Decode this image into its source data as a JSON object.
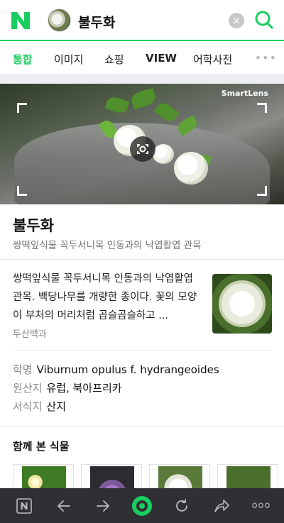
{
  "header": {
    "query": "불두화",
    "clear_label": "×"
  },
  "tabs": [
    {
      "label": "통합"
    },
    {
      "label": "이미지"
    },
    {
      "label": "쇼핑"
    },
    {
      "label": "VIEW"
    },
    {
      "label": "어학사전"
    }
  ],
  "tabs_more": "•••",
  "lens": {
    "brand": "SmartLens"
  },
  "result": {
    "title": "불두화",
    "subtitle": "쌍떡잎식물 꼭두서니목 인동과의 낙엽활엽 관목",
    "description": "쌍떡잎식물 꼭두서니목 인동과의 낙엽활엽 관목. 백당나무를 개량한 종이다. 꽃의 모양이 부처의 머리처럼 곱슬곱슬하고 ...",
    "source": "두산백과",
    "info": [
      {
        "label": "학명",
        "value": "Viburnum opulus f. hydrangeoides"
      },
      {
        "label": "원산지",
        "value": "유럽, 북아프리카"
      },
      {
        "label": "서식지",
        "value": "산지"
      }
    ]
  },
  "related": {
    "title": "함께 본 식물"
  },
  "bottom_bar": {
    "more_label": "ooo"
  },
  "colors": {
    "brand_green": "#19ce60",
    "bottom_bar": "#2e3033"
  }
}
